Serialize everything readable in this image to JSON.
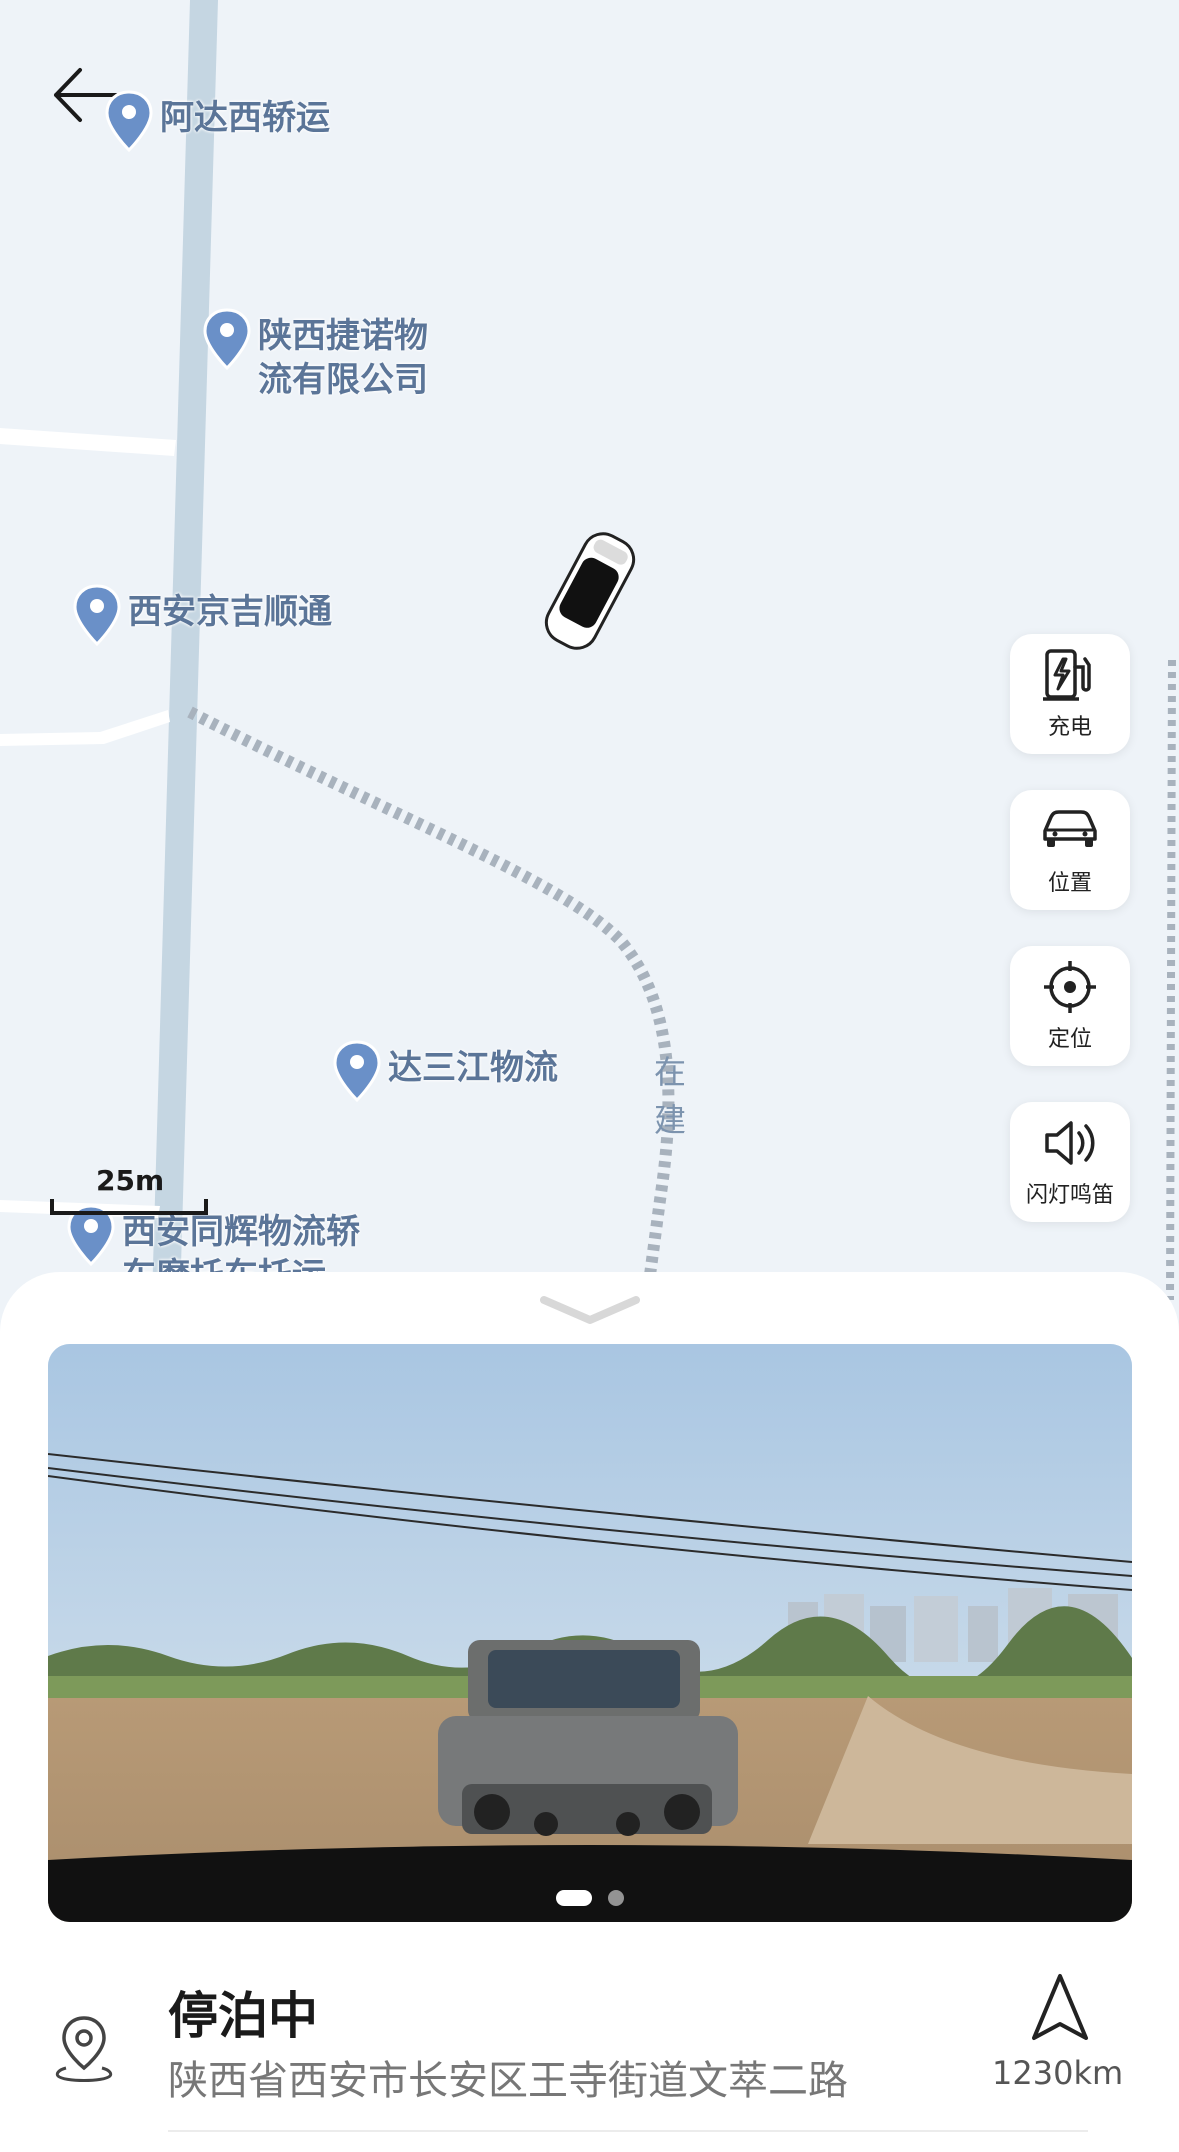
{
  "map": {
    "pois": [
      {
        "name": "阿达西轿运"
      },
      {
        "name": "陕西捷诺物\n流有限公司"
      },
      {
        "name": "西安京吉顺通"
      },
      {
        "name": "达三江物流"
      },
      {
        "name": "西安同辉物流轿\n车摩托车托运"
      }
    ],
    "construction_label": "在\n建",
    "scale_label": "25m"
  },
  "side_buttons": [
    {
      "label": "充电",
      "icon": "charging-station-icon"
    },
    {
      "label": "位置",
      "icon": "car-icon"
    },
    {
      "label": "定位",
      "icon": "crosshair-icon"
    },
    {
      "label": "闪灯鸣笛",
      "icon": "speaker-icon"
    }
  ],
  "status": {
    "title": "停泊中",
    "address": "陕西省西安市长安区王寺街道文萃二路",
    "distance": "1230km"
  },
  "carousel": {
    "pages": 2,
    "active": 1
  },
  "colors": {
    "road": "#c5d6e2",
    "poi_text": "#5b7598",
    "pin": "#6a90c8"
  }
}
